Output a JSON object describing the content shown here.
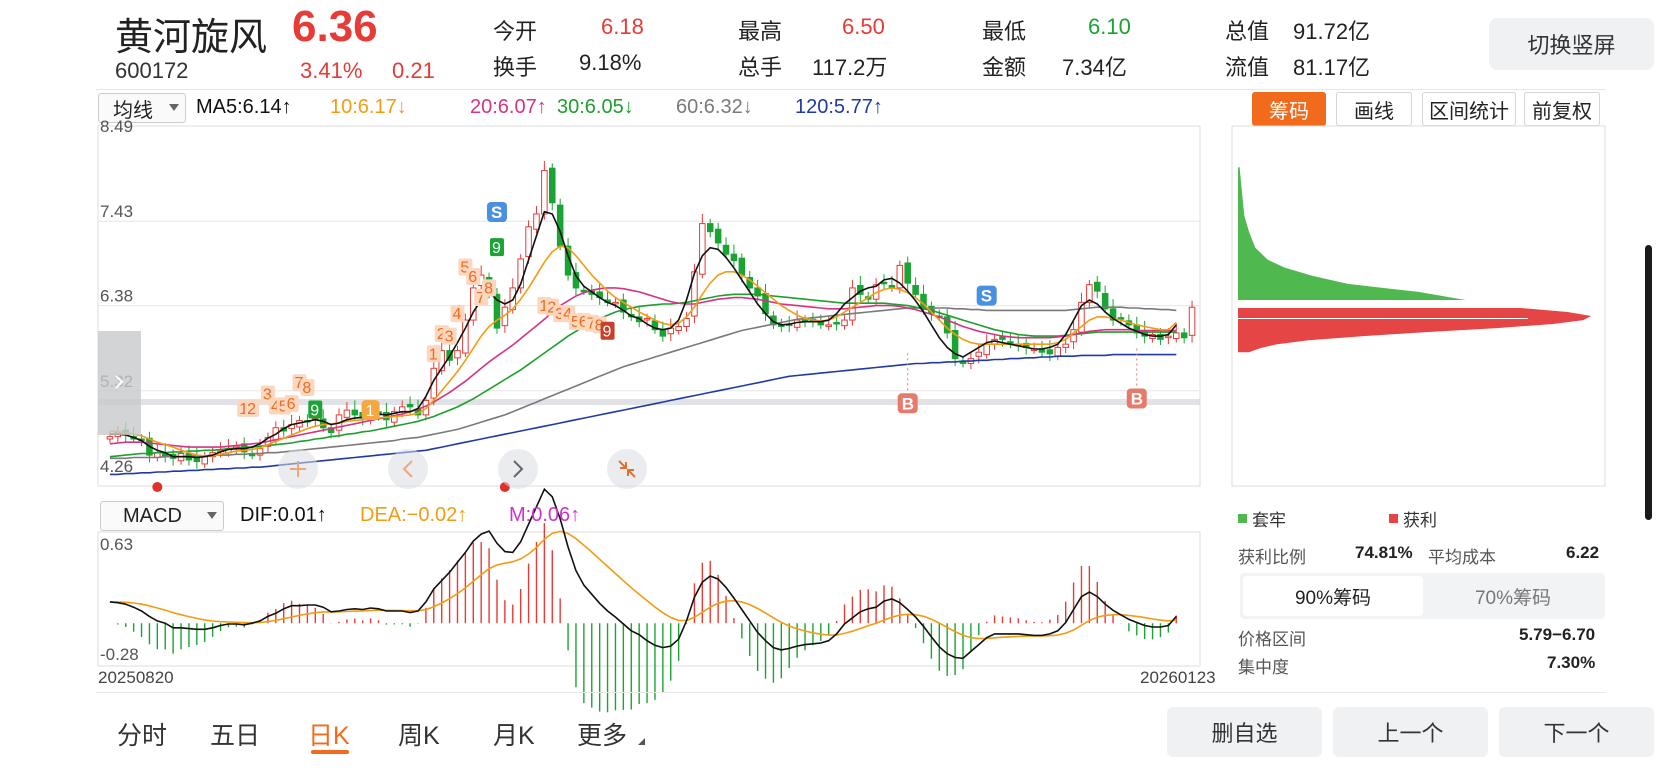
{
  "quote": {
    "name": "黄河旋风",
    "price": "6.36",
    "code": "600172",
    "change_pct": "3.41%",
    "change": "0.21",
    "open_label": "今开",
    "open": "6.18",
    "high_label": "最高",
    "high": "6.50",
    "low_label": "最低",
    "low": "6.10",
    "mktcap_label": "总值",
    "mktcap": "91.72亿",
    "turnover_label": "换手",
    "turnover": "9.18%",
    "volume_label": "总手",
    "volume": "117.2万",
    "amount_label": "金额",
    "amount": "7.34亿",
    "float_label": "流值",
    "float_cap": "81.17亿"
  },
  "switch_button": "切换竖屏",
  "ma_bar": {
    "select": "均线",
    "ma5": "MA5:6.14",
    "ma10": "10:6.17",
    "ma20": "20:6.07",
    "ma30": "30:6.05",
    "ma60": "60:6.32",
    "ma120": "120:5.77",
    "up_arrow": "↑",
    "down_arrow": "↓"
  },
  "tools": {
    "chips": "筹码",
    "draw": "画线",
    "range_stats": "区间统计",
    "adjust": "前复权"
  },
  "colors": {
    "up": "#e63b36",
    "down": "#19a433",
    "accent": "#f26a1b",
    "ma5": "#111111",
    "ma10": "#f39c12",
    "ma20": "#d63384",
    "ma30": "#1e9e2c",
    "ma60": "#7a7a7a",
    "ma120": "#1f3aa5",
    "dif": "#111111",
    "dea": "#f39c12",
    "m": "#cc33cc"
  },
  "macd_bar": {
    "select": "MACD",
    "dif": "DIF:0.01",
    "dea": "DEA:−0.02",
    "m": "M:0.06",
    "up_arrow": "↑"
  },
  "dates": {
    "start": "20250820",
    "end": "20260123"
  },
  "chip_panel": {
    "legend_trapped": "套牢",
    "legend_profit": "获利",
    "profit_ratio_label": "获利比例",
    "profit_ratio": "74.81%",
    "avg_cost_label": "平均成本",
    "avg_cost": "6.22",
    "tab_90": "90%筹码",
    "tab_70": "70%筹码",
    "price_range_label": "价格区间",
    "price_range": "5.79−6.70",
    "concentration_label": "集中度",
    "concentration": "7.30%"
  },
  "markers": {
    "sell": "S",
    "buy": "B",
    "nine": "9",
    "one": "1"
  },
  "period_tabs": [
    "分时",
    "五日",
    "日K",
    "周K",
    "月K",
    "更多"
  ],
  "bottom_buttons": {
    "remove": "删自选",
    "prev": "上一个",
    "next": "下一个"
  },
  "chart_data": {
    "type": "candlestick",
    "y_ticks": [
      8.49,
      7.43,
      6.38,
      5.32,
      4.26
    ],
    "ylim": [
      4.26,
      8.49
    ],
    "macd_ticks": [
      0.63,
      -0.28
    ],
    "macd_ylim": [
      -0.28,
      0.63
    ],
    "x_range": [
      "20250820",
      "20260123"
    ],
    "close": [
      4.75,
      4.8,
      4.78,
      4.72,
      4.7,
      4.52,
      4.55,
      4.5,
      4.48,
      4.54,
      4.46,
      4.44,
      4.5,
      4.55,
      4.58,
      4.6,
      4.63,
      4.56,
      4.52,
      4.6,
      4.74,
      4.86,
      4.82,
      4.9,
      4.95,
      4.94,
      5.0,
      4.86,
      4.8,
      5.02,
      5.08,
      5.02,
      4.98,
      5.06,
      5.02,
      4.96,
      5.06,
      5.12,
      5.12,
      5.02,
      5.2,
      5.6,
      5.82,
      5.7,
      5.82,
      6.2,
      6.6,
      6.76,
      6.52,
      6.1,
      6.36,
      6.6,
      6.96,
      7.36,
      7.52,
      8.06,
      7.66,
      7.12,
      6.76,
      6.6,
      6.56,
      6.52,
      6.48,
      6.42,
      6.42,
      6.3,
      6.24,
      6.18,
      6.22,
      6.08,
      6.0,
      6.1,
      6.12,
      6.22,
      6.8,
      7.4,
      7.3,
      7.16,
      7.02,
      6.94,
      6.76,
      6.6,
      6.5,
      6.28,
      6.14,
      6.12,
      6.14,
      6.2,
      6.18,
      6.2,
      6.14,
      6.14,
      6.16,
      6.2,
      6.6,
      6.52,
      6.46,
      6.64,
      6.66,
      6.6,
      6.88,
      6.66,
      6.52,
      6.34,
      6.28,
      6.24,
      6.04,
      5.72,
      5.66,
      5.72,
      5.8,
      5.9,
      5.96,
      5.96,
      5.9,
      5.88,
      5.86,
      5.84,
      5.8,
      5.78,
      5.86,
      5.9,
      6.08,
      6.42,
      6.64,
      6.56,
      6.34,
      6.2,
      6.22,
      6.14,
      6.04,
      6.0,
      6.02,
      5.96,
      6.0,
      6.04,
      5.98,
      6.36
    ],
    "volume_note": "",
    "ma5": [
      4.78,
      4.78,
      4.77,
      4.74,
      4.7,
      4.63,
      4.58,
      4.55,
      4.5,
      4.5,
      4.5,
      4.49,
      4.5,
      4.52,
      4.56,
      4.59,
      4.6,
      4.6,
      4.62,
      4.66,
      4.73,
      4.78,
      4.85,
      4.9,
      4.92,
      4.94,
      4.96,
      4.94,
      4.9,
      4.92,
      4.96,
      4.98,
      4.99,
      5.02,
      5.03,
      5.02,
      5.04,
      5.06,
      5.06,
      5.1,
      5.25,
      5.45,
      5.6,
      5.75,
      5.92,
      6.1,
      6.3,
      6.45,
      6.55,
      6.45,
      6.4,
      6.45,
      6.65,
      6.95,
      7.25,
      7.55,
      7.52,
      7.3,
      7.0,
      6.75,
      6.62,
      6.55,
      6.48,
      6.42,
      6.38,
      6.32,
      6.25,
      6.22,
      6.15,
      6.1,
      6.08,
      6.1,
      6.2,
      6.45,
      6.78,
      7.0,
      7.1,
      7.08,
      6.98,
      6.85,
      6.7,
      6.55,
      6.4,
      6.28,
      6.18,
      6.14,
      6.15,
      6.17,
      6.18,
      6.18,
      6.18,
      6.2,
      6.28,
      6.4,
      6.48,
      6.56,
      6.6,
      6.62,
      6.7,
      6.72,
      6.66,
      6.56,
      6.44,
      6.3,
      6.14,
      5.98,
      5.86,
      5.78,
      5.74,
      5.8,
      5.86,
      5.92,
      5.94,
      5.92,
      5.9,
      5.88,
      5.86,
      5.84,
      5.84,
      5.86,
      5.9,
      6.02,
      6.2,
      6.38,
      6.45,
      6.4,
      6.3,
      6.22,
      6.16,
      6.1,
      6.06,
      6.02,
      6.0,
      6.0,
      6.02,
      6.14
    ],
    "ma10": [
      4.82,
      4.81,
      4.8,
      4.78,
      4.76,
      4.72,
      4.68,
      4.65,
      4.62,
      4.58,
      4.55,
      4.52,
      4.51,
      4.51,
      4.53,
      4.55,
      4.57,
      4.58,
      4.59,
      4.61,
      4.65,
      4.69,
      4.73,
      4.77,
      4.81,
      4.85,
      4.88,
      4.9,
      4.91,
      4.92,
      4.94,
      4.95,
      4.96,
      4.97,
      4.98,
      4.99,
      5.0,
      5.01,
      5.02,
      5.04,
      5.1,
      5.2,
      5.32,
      5.44,
      5.56,
      5.7,
      5.85,
      6.0,
      6.12,
      6.2,
      6.26,
      6.34,
      6.46,
      6.6,
      6.76,
      6.92,
      7.05,
      7.12,
      7.1,
      7.0,
      6.88,
      6.76,
      6.66,
      6.56,
      6.48,
      6.42,
      6.36,
      6.3,
      6.25,
      6.2,
      6.16,
      6.14,
      6.16,
      6.24,
      6.36,
      6.52,
      6.66,
      6.76,
      6.8,
      6.8,
      6.76,
      6.7,
      6.62,
      6.54,
      6.46,
      6.38,
      6.32,
      6.26,
      6.22,
      6.2,
      6.19,
      6.2,
      6.24,
      6.3,
      6.36,
      6.42,
      6.48,
      6.54,
      6.58,
      6.6,
      6.58,
      6.54,
      6.48,
      6.4,
      6.3,
      6.2,
      6.1,
      6.02,
      5.96,
      5.92,
      5.9,
      5.9,
      5.9,
      5.9,
      5.9,
      5.9,
      5.9,
      5.9,
      5.9,
      5.9,
      5.92,
      5.96,
      6.04,
      6.12,
      6.2,
      6.24,
      6.24,
      6.22,
      6.2,
      6.17,
      6.14,
      6.12,
      6.1,
      6.08,
      6.08,
      6.17
    ],
    "ma20": [
      4.66,
      4.67,
      4.68,
      4.68,
      4.68,
      4.67,
      4.66,
      4.65,
      4.64,
      4.63,
      4.62,
      4.62,
      4.62,
      4.62,
      4.62,
      4.63,
      4.64,
      4.65,
      4.66,
      4.67,
      4.69,
      4.71,
      4.73,
      4.75,
      4.77,
      4.79,
      4.81,
      4.83,
      4.85,
      4.87,
      4.89,
      4.91,
      4.93,
      4.95,
      4.97,
      4.99,
      5.01,
      5.03,
      5.06,
      5.09,
      5.13,
      5.18,
      5.24,
      5.3,
      5.37,
      5.44,
      5.52,
      5.6,
      5.68,
      5.75,
      5.82,
      5.89,
      5.97,
      6.05,
      6.13,
      6.21,
      6.3,
      6.38,
      6.44,
      6.5,
      6.54,
      6.57,
      6.59,
      6.6,
      6.6,
      6.59,
      6.57,
      6.55,
      6.52,
      6.49,
      6.46,
      6.43,
      6.41,
      6.4,
      6.4,
      6.42,
      6.44,
      6.46,
      6.47,
      6.48,
      6.48,
      6.47,
      6.46,
      6.44,
      6.42,
      6.4,
      6.39,
      6.38,
      6.37,
      6.36,
      6.35,
      6.34,
      6.34,
      6.34,
      6.35,
      6.36,
      6.37,
      6.38,
      6.38,
      6.38,
      6.37,
      6.35,
      6.33,
      6.3,
      6.27,
      6.24,
      6.2,
      6.16,
      6.12,
      6.09,
      6.06,
      6.04,
      6.02,
      6.0,
      5.99,
      5.98,
      5.98,
      5.98,
      5.98,
      5.98,
      5.99,
      6.0,
      6.02,
      6.04,
      6.06,
      6.07,
      6.08,
      6.08,
      6.08,
      6.08,
      6.07,
      6.07,
      6.07,
      6.07,
      6.07,
      6.07
    ],
    "ma30": [
      4.5,
      4.51,
      4.52,
      4.53,
      4.54,
      4.54,
      4.55,
      4.55,
      4.56,
      4.56,
      4.57,
      4.57,
      4.58,
      4.58,
      4.59,
      4.6,
      4.61,
      4.62,
      4.62,
      4.63,
      4.64,
      4.65,
      4.66,
      4.67,
      4.69,
      4.7,
      4.72,
      4.73,
      4.75,
      4.76,
      4.78,
      4.79,
      4.81,
      4.82,
      4.84,
      4.86,
      4.88,
      4.9,
      4.92,
      4.94,
      4.97,
      5.0,
      5.04,
      5.08,
      5.12,
      5.17,
      5.22,
      5.28,
      5.34,
      5.4,
      5.46,
      5.52,
      5.58,
      5.65,
      5.72,
      5.79,
      5.86,
      5.93,
      6.0,
      6.06,
      6.12,
      6.17,
      6.22,
      6.26,
      6.3,
      6.33,
      6.35,
      6.37,
      6.38,
      6.39,
      6.4,
      6.4,
      6.41,
      6.42,
      6.44,
      6.46,
      6.48,
      6.5,
      6.51,
      6.52,
      6.52,
      6.52,
      6.52,
      6.51,
      6.5,
      6.49,
      6.48,
      6.47,
      6.46,
      6.45,
      6.44,
      6.43,
      6.42,
      6.41,
      6.41,
      6.41,
      6.41,
      6.41,
      6.41,
      6.4,
      6.39,
      6.38,
      6.36,
      6.34,
      6.32,
      6.29,
      6.26,
      6.23,
      6.2,
      6.17,
      6.14,
      6.11,
      6.08,
      6.06,
      6.04,
      6.02,
      6.01,
      6.0,
      6.0,
      6.0,
      6.0,
      6.01,
      6.02,
      6.03,
      6.04,
      6.05,
      6.05,
      6.05,
      6.05,
      6.05,
      6.05,
      6.05,
      6.05,
      6.05,
      6.05,
      6.05
    ],
    "ma60": [
      4.48,
      4.48,
      4.48,
      4.49,
      4.49,
      4.49,
      4.49,
      4.5,
      4.5,
      4.5,
      4.51,
      4.51,
      4.51,
      4.52,
      4.52,
      4.52,
      4.53,
      4.53,
      4.54,
      4.54,
      4.55,
      4.55,
      4.56,
      4.57,
      4.58,
      4.59,
      4.6,
      4.61,
      4.62,
      4.63,
      4.64,
      4.65,
      4.66,
      4.67,
      4.68,
      4.69,
      4.7,
      4.72,
      4.73,
      4.74,
      4.76,
      4.78,
      4.8,
      4.82,
      4.84,
      4.87,
      4.9,
      4.93,
      4.96,
      4.99,
      5.02,
      5.06,
      5.1,
      5.14,
      5.18,
      5.22,
      5.26,
      5.3,
      5.34,
      5.38,
      5.42,
      5.46,
      5.5,
      5.54,
      5.58,
      5.62,
      5.65,
      5.68,
      5.71,
      5.74,
      5.77,
      5.8,
      5.83,
      5.86,
      5.89,
      5.92,
      5.95,
      5.98,
      6.01,
      6.04,
      6.07,
      6.09,
      6.11,
      6.13,
      6.15,
      6.17,
      6.19,
      6.21,
      6.22,
      6.23,
      6.24,
      6.25,
      6.26,
      6.27,
      6.28,
      6.29,
      6.3,
      6.31,
      6.32,
      6.33,
      6.34,
      6.35,
      6.35,
      6.35,
      6.35,
      6.35,
      6.35,
      6.34,
      6.34,
      6.33,
      6.33,
      6.32,
      6.32,
      6.32,
      6.32,
      6.32,
      6.32,
      6.32,
      6.32,
      6.32,
      6.32,
      6.32,
      6.33,
      6.34,
      6.35,
      6.36,
      6.36,
      6.36,
      6.36,
      6.35,
      6.35,
      6.34,
      6.34,
      6.33,
      6.33,
      6.32
    ],
    "ma120": [
      4.28,
      4.28,
      4.29,
      4.29,
      4.3,
      4.3,
      4.31,
      4.31,
      4.32,
      4.32,
      4.33,
      4.33,
      4.34,
      4.34,
      4.35,
      4.35,
      4.36,
      4.36,
      4.37,
      4.37,
      4.38,
      4.39,
      4.4,
      4.41,
      4.42,
      4.43,
      4.44,
      4.45,
      4.46,
      4.47,
      4.48,
      4.49,
      4.5,
      4.51,
      4.52,
      4.53,
      4.54,
      4.55,
      4.56,
      4.57,
      4.58,
      4.6,
      4.62,
      4.64,
      4.66,
      4.68,
      4.7,
      4.72,
      4.74,
      4.76,
      4.78,
      4.8,
      4.82,
      4.84,
      4.86,
      4.88,
      4.9,
      4.92,
      4.94,
      4.96,
      4.98,
      5.0,
      5.02,
      5.04,
      5.06,
      5.08,
      5.1,
      5.12,
      5.14,
      5.16,
      5.18,
      5.2,
      5.22,
      5.24,
      5.26,
      5.28,
      5.3,
      5.32,
      5.34,
      5.36,
      5.38,
      5.4,
      5.42,
      5.44,
      5.46,
      5.48,
      5.5,
      5.51,
      5.52,
      5.53,
      5.54,
      5.55,
      5.56,
      5.57,
      5.58,
      5.59,
      5.6,
      5.61,
      5.62,
      5.63,
      5.64,
      5.65,
      5.66,
      5.66,
      5.67,
      5.67,
      5.68,
      5.68,
      5.69,
      5.69,
      5.7,
      5.7,
      5.71,
      5.71,
      5.72,
      5.72,
      5.73,
      5.73,
      5.74,
      5.74,
      5.75,
      5.75,
      5.75,
      5.76,
      5.76,
      5.76,
      5.76,
      5.77,
      5.77,
      5.77,
      5.77,
      5.77,
      5.77,
      5.77,
      5.77,
      5.77
    ],
    "chip_profile": {
      "trapped": [
        [
          8.1,
          2
        ],
        [
          7.9,
          4
        ],
        [
          7.7,
          6
        ],
        [
          7.5,
          8
        ],
        [
          7.3,
          14
        ],
        [
          7.1,
          22
        ],
        [
          6.95,
          38
        ],
        [
          6.85,
          60
        ],
        [
          6.75,
          95
        ],
        [
          6.65,
          140
        ],
        [
          6.55,
          230
        ],
        [
          6.45,
          290
        ]
      ],
      "profit": [
        [
          6.35,
          360
        ],
        [
          6.3,
          420
        ],
        [
          6.25,
          450
        ],
        [
          6.2,
          440
        ],
        [
          6.15,
          400
        ],
        [
          6.1,
          330
        ],
        [
          6.05,
          240
        ],
        [
          6.0,
          160
        ],
        [
          5.95,
          90
        ],
        [
          5.9,
          50
        ],
        [
          5.85,
          28
        ],
        [
          5.8,
          14
        ]
      ]
    }
  }
}
